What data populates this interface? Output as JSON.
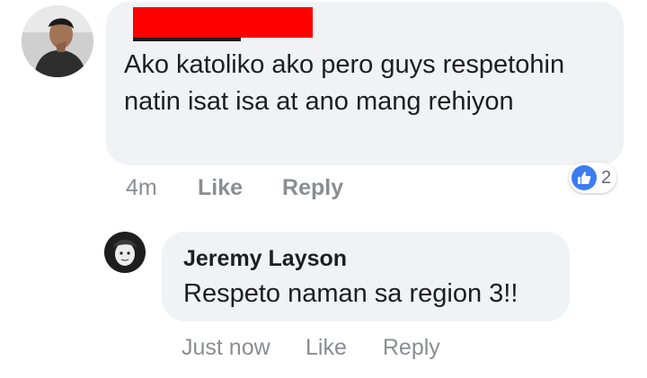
{
  "top_comment": {
    "author_redacted": true,
    "text": "Ako katoliko ako pero guys respetohin natin isat isa at ano mang rehiyon",
    "timestamp": "4m",
    "like_label": "Like",
    "reply_label": "Reply",
    "reaction_icon": "like-icon",
    "reaction_count": "2",
    "colors": {
      "bubble": "#f0f2f5",
      "redaction": "#ff0000",
      "like": "#3b7df0"
    }
  },
  "reply_comment": {
    "author": "Jeremy Layson",
    "text": "Respeto naman sa region 3!!",
    "timestamp": "Just now",
    "like_label": "Like",
    "reply_label": "Reply"
  }
}
